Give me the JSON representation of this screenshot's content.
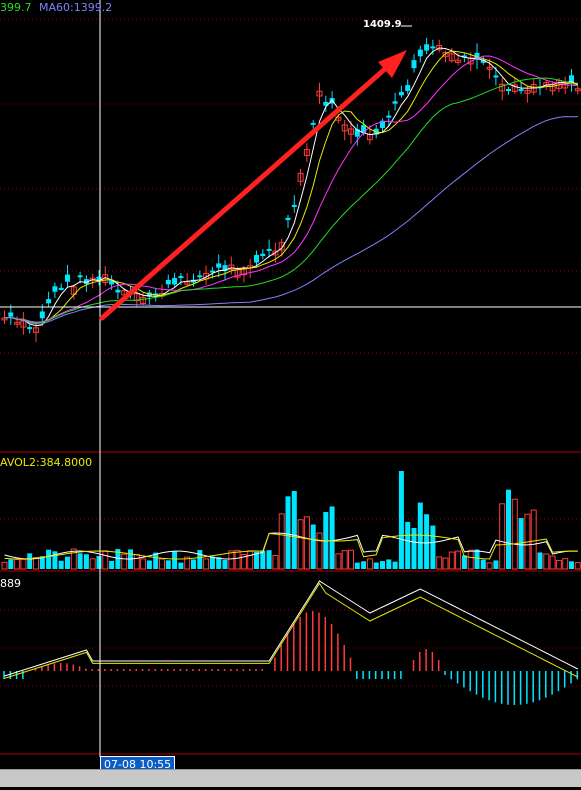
{
  "legend": {
    "ma_partial": "399.7",
    "ma60": "MA60:1399.2",
    "vol": "AVOL2:384.8000",
    "macd": "889"
  },
  "peak_label": "1409.9",
  "crosshair_time": "07-08 10:55",
  "colors": {
    "up": "#ff3b3b",
    "down": "#00e5ff",
    "ma5": "#ffffff",
    "ma10": "#e8e800",
    "ma20": "#ff33ff",
    "ma30": "#22dd22",
    "ma60": "#8080ff",
    "grid": "#8b0000",
    "arrow": "#ff2020"
  },
  "chart_data": [
    {
      "type": "candlestick",
      "panel": "price",
      "annotations": [
        "1409.9"
      ],
      "overlays": [
        "MA5",
        "MA10",
        "MA20",
        "MA30",
        "MA60"
      ],
      "trend_arrow": "upward"
    },
    {
      "type": "bar",
      "panel": "volume",
      "legend": [
        "AVOL2:384.8000"
      ]
    },
    {
      "type": "bar",
      "panel": "macd",
      "legend": [
        "889"
      ]
    }
  ]
}
